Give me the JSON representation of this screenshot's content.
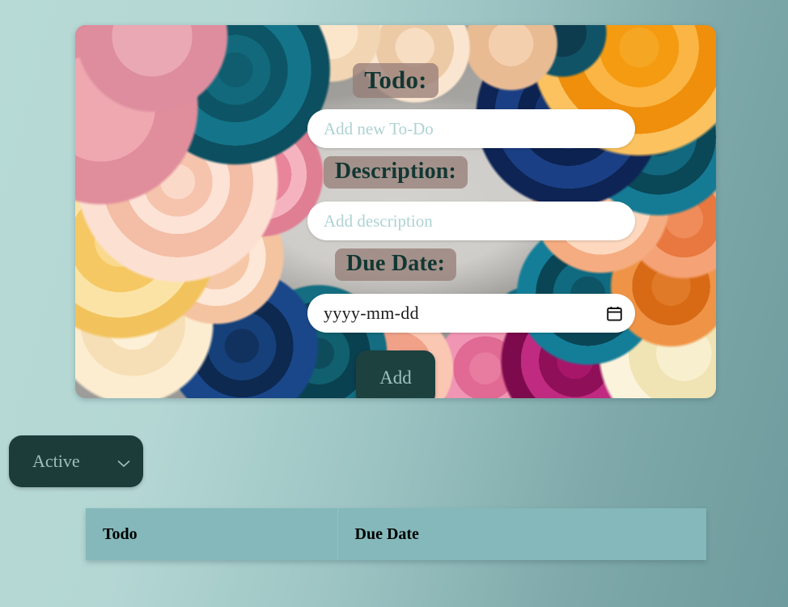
{
  "theme": {
    "page_bg_start": "#b7dad6",
    "page_bg_end": "#6e9b9e",
    "chip_bg": "#967d76",
    "chip_text": "#123733",
    "button_bg": "#1c413f",
    "button_text": "#9fc3bc",
    "select_bg": "#1c3c3a",
    "select_text": "#9cc0b9",
    "table_header_bg": "#84b8ba",
    "table_header_text": "#000000",
    "input_bg": "#ffffff",
    "placeholder_color": "#aed2d2"
  },
  "form": {
    "todo": {
      "label": "Todo:",
      "placeholder": "Add new To-Do",
      "value": ""
    },
    "description": {
      "label": "Description:",
      "placeholder": "Add description",
      "value": ""
    },
    "due_date": {
      "label": "Due Date:",
      "placeholder": "yyyy-mm-dd",
      "value": "",
      "icon": "calendar-icon"
    },
    "submit": {
      "label": "Add"
    }
  },
  "filter": {
    "selected": "Active",
    "icon": "chevron-down-icon",
    "options": [
      "Active"
    ]
  },
  "table": {
    "columns": [
      {
        "key": "todo",
        "label": "Todo"
      },
      {
        "key": "due_date",
        "label": "Due Date"
      }
    ],
    "rows": []
  }
}
